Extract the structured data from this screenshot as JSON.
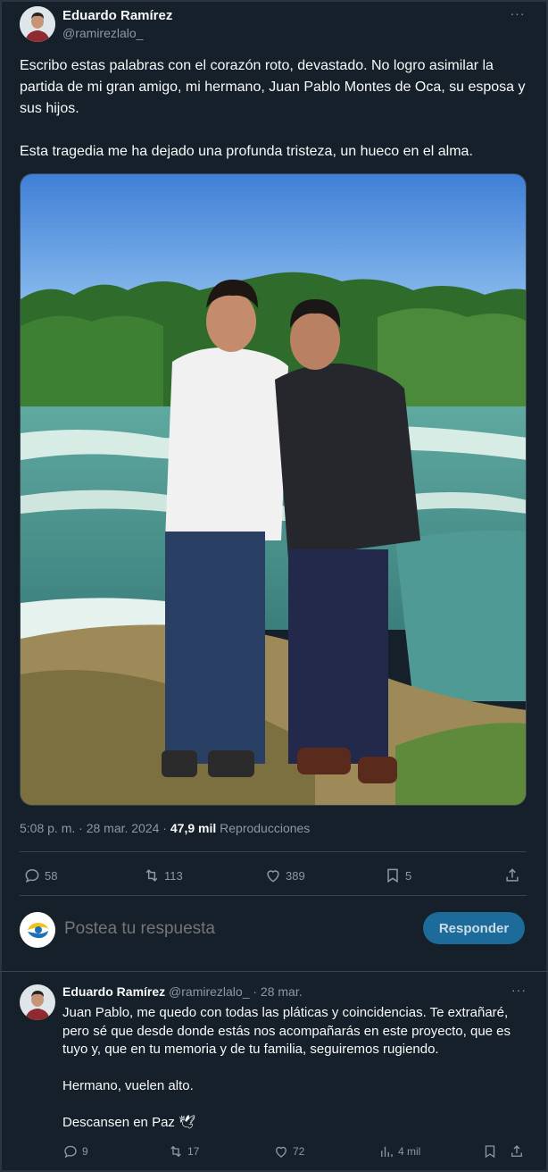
{
  "tweet": {
    "author_name": "Eduardo Ramírez",
    "author_handle": "@ramirezlalo_",
    "more_label": "···",
    "paragraph1": "Escribo estas palabras con el corazón roto, devastado. No logro asimilar la partida de mi gran amigo, mi hermano, Juan Pablo Montes de Oca, su esposa y sus hijos.",
    "paragraph2": "Esta tragedia me ha dejado una profunda tristeza, un hueco en el alma.",
    "time": "5:08 p. m. · 28 mar. 2024 · ",
    "views_count": "47,9 mil",
    "views_label": " Reproducciones",
    "replies": "58",
    "retweets": "113",
    "likes": "389",
    "bookmarks": "5"
  },
  "reply_composer": {
    "placeholder": "Postea tu respuesta",
    "button_label": "Responder"
  },
  "reply": {
    "author_name": "Eduardo Ramírez",
    "author_handle": " @ramirezlalo_ · 28 mar.",
    "more_label": "···",
    "paragraph1": "Juan Pablo, me quedo con todas las pláticas y coincidencias. Te extrañaré, pero sé que desde donde estás nos acompañarás en este proyecto, que es tuyo y, que en tu memoria y de tu familia, seguiremos rugiendo.",
    "paragraph2": "Hermano, vuelen alto.",
    "paragraph3": "Descansen en Paz 🕊",
    "replies": "9",
    "retweets": "17",
    "likes": "72",
    "views": "4 mil"
  },
  "colors": {
    "background": "#15202b",
    "muted_text": "#8b98a5",
    "accent_button": "#1d6b9a"
  }
}
